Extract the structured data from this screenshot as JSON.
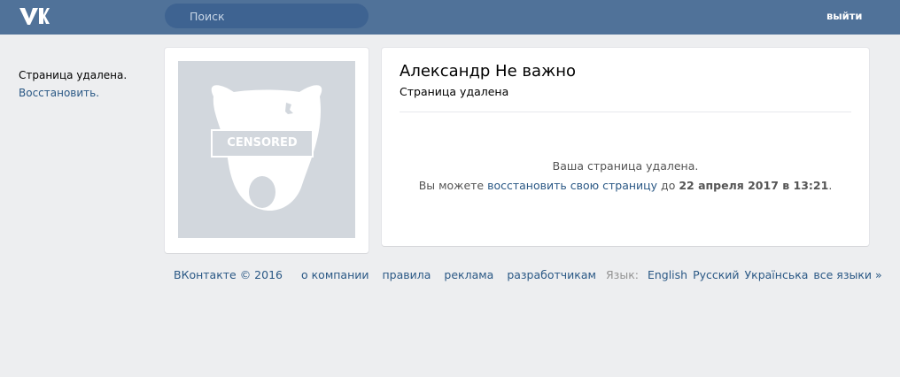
{
  "header": {
    "logo_icon": "vk-logo-icon",
    "search_placeholder": "Поиск",
    "logout_label": "выйти"
  },
  "left": {
    "deleted_text": "Страница удалена.",
    "restore_link": "Восстановить."
  },
  "photo": {
    "stamp_text": "CENSORED"
  },
  "profile": {
    "name": "Александр Не важно",
    "status": "Страница удалена",
    "message_line1": "Ваша страница удалена.",
    "message_line2_prefix": "Вы можете",
    "message_line2_link": "восстановить свою страницу",
    "message_line2_middle": "до",
    "message_line2_date": "22 апреля 2017 в 13:21",
    "message_line2_suffix": "."
  },
  "footer": {
    "copyright": "ВКонтакте © 2016",
    "links": [
      "о компании",
      "правила",
      "реклама",
      "разработчикам"
    ],
    "language_label": "Язык:",
    "languages": [
      "English",
      "Русский",
      "Українська",
      "все языки »"
    ]
  },
  "colors": {
    "header_bg": "#507299",
    "link": "#2a5885",
    "page_bg": "#edeef0"
  }
}
